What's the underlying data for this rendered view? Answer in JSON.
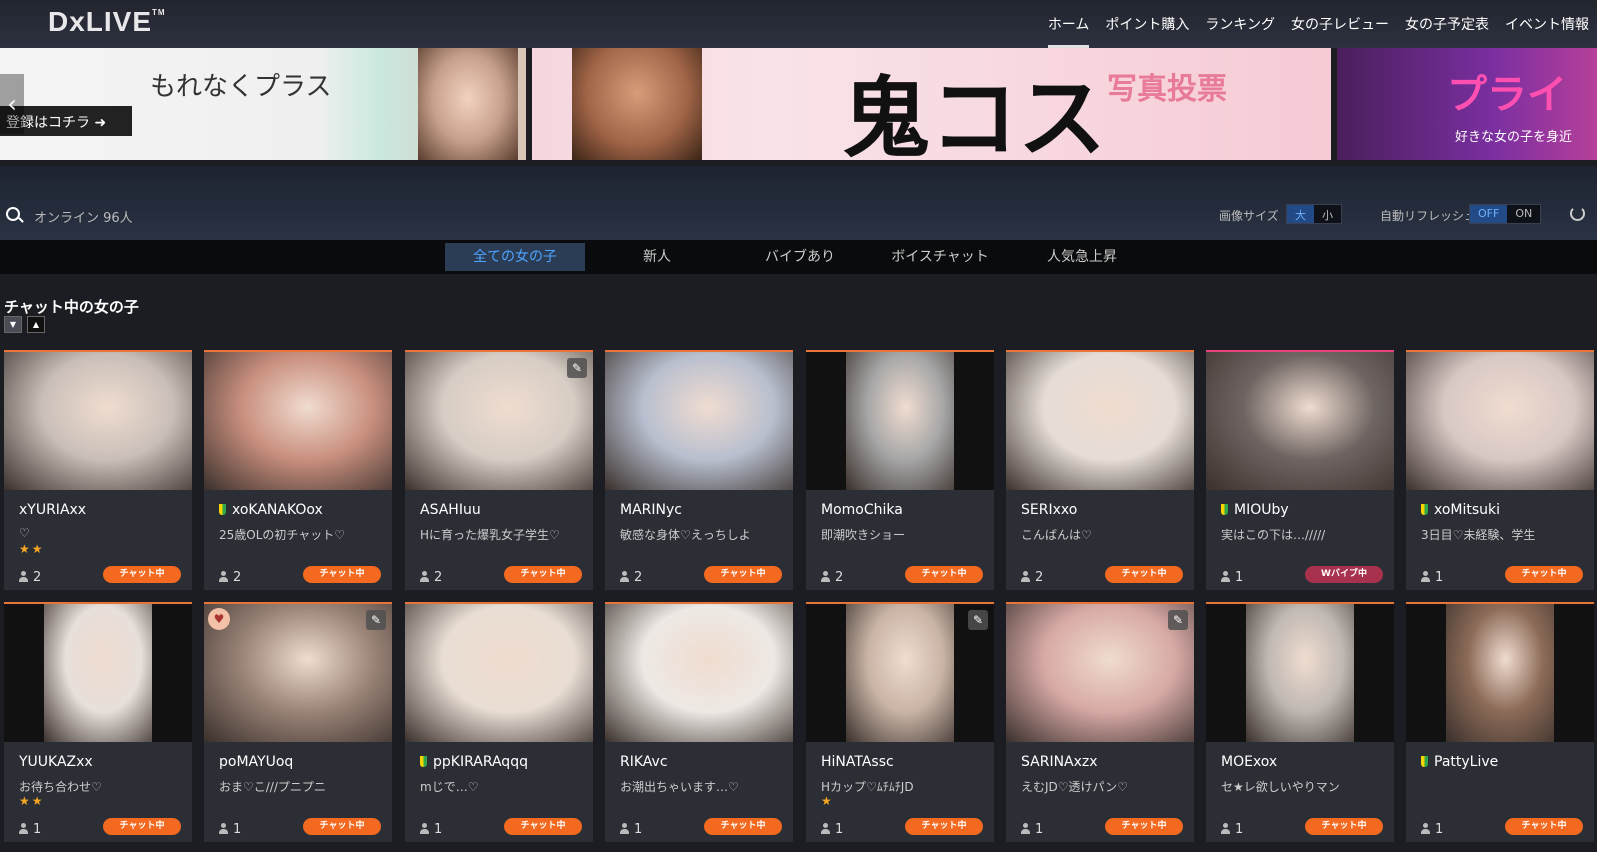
{
  "header": {
    "logo": "DxLIVE",
    "logo_tm": "TM",
    "nav": [
      "ホーム",
      "ポイント購入",
      "ランキング",
      "女の子レビュー",
      "女の子予定表",
      "イベント情報"
    ]
  },
  "banners": {
    "b1_text": "もれなくプラス",
    "b1_button": "登録はコチラ ➜",
    "b2_title": "鬼コス",
    "b2_sub": "写真投票",
    "b3_title": "プライ",
    "b3_sub": "好きな女の子を身近"
  },
  "toolbar": {
    "online": "オンライン 96人",
    "image_size_label": "画像サイズ",
    "image_size_large": "大",
    "image_size_small": "小",
    "auto_refresh_label": "自動リフレッシュ",
    "off": "OFF",
    "on": "ON"
  },
  "tabs": [
    "全ての女の子",
    "新人",
    "バイブあり",
    "ボイスチャット",
    "人気急上昇"
  ],
  "section": {
    "title": "チャット中の女の子"
  },
  "cards": [
    {
      "name": "xYURIAxx",
      "desc": "♡",
      "stars": "★★",
      "viewers": "2",
      "status": "チャット中",
      "beginner": false,
      "color": "#c9bfb8"
    },
    {
      "name": "xoKANAKOox",
      "desc": "25歳OLの初チャット♡",
      "stars": "",
      "viewers": "2",
      "status": "チャット中",
      "beginner": true,
      "color": "#c98f7e"
    },
    {
      "name": "ASAHIuu",
      "desc": "Hに育った爆乳女子学生♡",
      "stars": "",
      "viewers": "2",
      "status": "チャット中",
      "beginner": false,
      "color": "#d6cdc4"
    },
    {
      "name": "MARINyc",
      "desc": "敏感な身体♡えっちしよ",
      "stars": "",
      "viewers": "2",
      "status": "チャット中",
      "beginner": false,
      "color": "#b8bfcf"
    },
    {
      "name": "MomoChika",
      "desc": "即潮吹きショー",
      "stars": "",
      "viewers": "2",
      "status": "チャット中",
      "beginner": false,
      "color": "#a7a7a7"
    },
    {
      "name": "SERIxxo",
      "desc": "こんばんは♡",
      "stars": "",
      "viewers": "2",
      "status": "チャット中",
      "beginner": false,
      "color": "#e5ddd6"
    },
    {
      "name": "MIOUby",
      "desc": "実はこの下は…/////",
      "stars": "",
      "viewers": "1",
      "status": "Wバイブ中",
      "beginner": true,
      "color": "#6e6562"
    },
    {
      "name": "xoMitsuki",
      "desc": "3日目♡未経験、学生",
      "stars": "",
      "viewers": "1",
      "status": "チャット中",
      "beginner": true,
      "color": "#d8c8c4"
    },
    {
      "name": "YUUKAZxx",
      "desc": "お待ち合わせ♡",
      "stars": "★★",
      "viewers": "1",
      "status": "チャット中",
      "beginner": false,
      "color": "#e7dfda"
    },
    {
      "name": "poMAYUoq",
      "desc": "おま♡こ///プニプニ",
      "stars": "",
      "viewers": "1",
      "status": "チャット中",
      "beginner": false,
      "color": "#9b8478"
    },
    {
      "name": "ppKIRARAqqq",
      "desc": "mじで…♡",
      "stars": "",
      "viewers": "1",
      "status": "チャット中",
      "beginner": true,
      "color": "#e9ded4"
    },
    {
      "name": "RIKAvc",
      "desc": "お潮出ちゃいます…♡",
      "stars": "",
      "viewers": "1",
      "status": "チャット中",
      "beginner": false,
      "color": "#ede9e4"
    },
    {
      "name": "HiNATAssc",
      "desc": "Hカップ♡ﾑﾁﾑﾁJD",
      "stars": "★",
      "viewers": "1",
      "status": "チャット中",
      "beginner": false,
      "color": "#c9b4a6"
    },
    {
      "name": "SARINAxzx",
      "desc": "えむJD♡透けパン♡",
      "stars": "",
      "viewers": "1",
      "status": "チャット中",
      "beginner": false,
      "color": "#d7a9a6"
    },
    {
      "name": "MOExox",
      "desc": "セ★レ欲しいやりマン",
      "stars": "",
      "viewers": "1",
      "status": "チャット中",
      "beginner": false,
      "color": "#bfb8b2"
    },
    {
      "name": "PattyLive",
      "desc": "",
      "stars": "",
      "viewers": "1",
      "status": "チャット中",
      "beginner": true,
      "color": "#8c6b58"
    }
  ]
}
